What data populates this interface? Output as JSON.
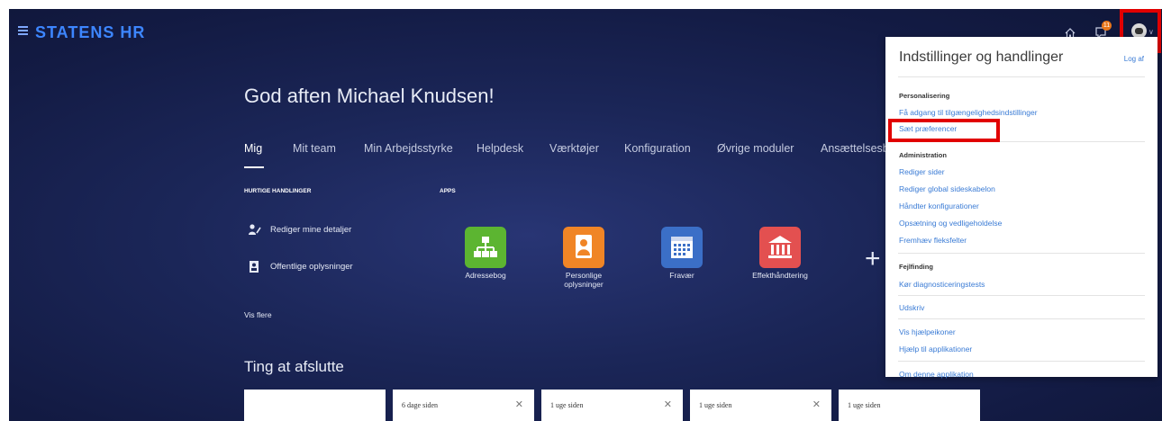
{
  "header": {
    "brand": "STATENS HR",
    "notification_count": "11",
    "icons": {
      "menu": "hamburger-icon",
      "home": "home-icon",
      "notifications": "notifications-icon",
      "avatar": "user-avatar",
      "chevron": "chevron-down-icon"
    }
  },
  "main": {
    "greeting": "God aften Michael Knudsen!",
    "tabs": [
      "Mig",
      "Mit team",
      "Min Arbejdsstyrke",
      "Helpdesk",
      "Værktøjer",
      "Konfiguration",
      "Øvrige moduler",
      "Ansættelsesbr"
    ],
    "active_tab": "Mig",
    "quick_actions_label": "HURTIGE HANDLINGER",
    "quick_actions": [
      "Rediger mine detaljer",
      "Offentlige oplysninger"
    ],
    "show_more": "Vis flere",
    "apps_label": "APPS",
    "apps": [
      {
        "label": "Adressebog",
        "color": "#5cb531",
        "icon": "org-chart-icon"
      },
      {
        "label": "Personlige oplysninger",
        "color": "#f08526",
        "icon": "person-badge-icon"
      },
      {
        "label": "Fravær",
        "color": "#3b6fc7",
        "icon": "calendar-icon"
      },
      {
        "label": "Effekthåndtering",
        "color": "#e35050",
        "icon": "building-icon"
      }
    ],
    "todo_title": "Ting at afslutte",
    "todo_cards": [
      {
        "time": ""
      },
      {
        "time": "6 dage siden"
      },
      {
        "time": "1 uge siden"
      },
      {
        "time": "1 uge siden"
      },
      {
        "time": "1 uge siden"
      }
    ]
  },
  "dropdown": {
    "title": "Indstillinger og handlinger",
    "logout": "Log af",
    "sections": [
      {
        "heading": "Personalisering",
        "links": [
          "Få adgang til tilgængelighedsindstillinger",
          "Sæt præferencer"
        ]
      },
      {
        "heading": "Administration",
        "links": [
          "Rediger sider",
          "Rediger global sideskabelon",
          "Håndter konfigurationer",
          "Opsætning og vedligeholdelse",
          "Fremhæv fleksfelter"
        ]
      },
      {
        "heading": "Fejlfinding",
        "links": [
          "Kør diagnosticeringstests"
        ]
      },
      {
        "heading": "",
        "links": [
          "Udskriv"
        ]
      },
      {
        "heading": "",
        "links": [
          "Vis hjælpeikoner",
          "Hjælp til applikationer"
        ]
      },
      {
        "heading": "",
        "links": [
          "Om denne applikation"
        ]
      }
    ]
  },
  "colors": {
    "accent": "#3d86ff",
    "link": "#3a7bd5",
    "highlight": "#e10000",
    "badge": "#e8761a"
  }
}
